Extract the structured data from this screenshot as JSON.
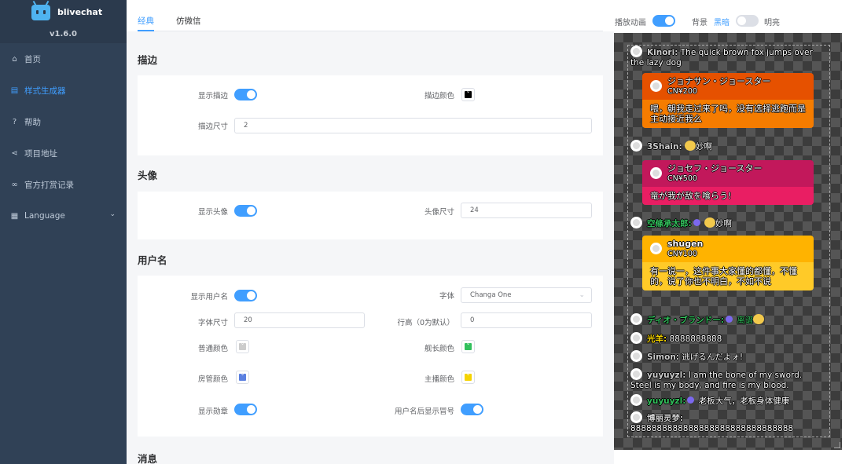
{
  "app": {
    "title": "blivechat",
    "version": "v1.6.0"
  },
  "sidebar": {
    "items": [
      {
        "label": "首页"
      },
      {
        "label": "样式生成器"
      },
      {
        "label": "帮助"
      },
      {
        "label": "项目地址"
      },
      {
        "label": "官方打赏记录"
      },
      {
        "label": "Language"
      }
    ]
  },
  "tabs": [
    "经典",
    "仿微信"
  ],
  "sections": {
    "outline": {
      "title": "描边",
      "show_label": "显示描边",
      "color_label": "描边颜色",
      "color": "#000000",
      "size_label": "描边尺寸",
      "size": "2"
    },
    "avatar": {
      "title": "头像",
      "show_label": "显示头像",
      "size_label": "头像尺寸",
      "size": "24"
    },
    "username": {
      "title": "用户名",
      "show_label": "显示用户名",
      "font_label": "字体",
      "font": "Changa One",
      "fontsize_label": "字体尺寸",
      "fontsize": "20",
      "lineheight_label": "行高（0为默认）",
      "lineheight": "0",
      "normal_color_label": "普通颜色",
      "normal_color": "#cccccc",
      "captain_color_label": "舰长颜色",
      "captain_color": "#32c05c",
      "admin_color_label": "房管颜色",
      "admin_color": "#5a7fe0",
      "owner_color_label": "主播颜色",
      "owner_color": "#f5d300",
      "medal_label": "显示勋章",
      "after_medal_label": "用户名后显示冒号"
    },
    "message": {
      "title": "消息"
    }
  },
  "topbar": {
    "anim_label": "播放动画",
    "bg_label": "背景",
    "dark_label": "黑暗",
    "light_label": "明亮"
  },
  "colors": {
    "accent": "#409eff",
    "sidebar": "#304156"
  },
  "preview": {
    "m1": {
      "name": "Kinori:",
      "text": "The quick brown fox jumps over the lazy dog"
    },
    "sc1": {
      "name": "ジョナサン・ジョースター",
      "price": "CN¥200",
      "text": "喂，朝我走过来了吗，没有选择逃跑而是主动接近我么"
    },
    "m2": {
      "name": "3Shain:",
      "text": "妙啊"
    },
    "sc2": {
      "name": "ジョセフ・ジョースター",
      "price": "CN¥500",
      "text": "竜が我が敌を喰らう!"
    },
    "m3": {
      "name": "空條承太郎:",
      "text": "妙啊"
    },
    "sc3": {
      "name": "shugen",
      "price": "CN¥100",
      "text": "有一说一，这件事大家懂的都懂，不懂的，说了你也不明白，不如不说"
    },
    "m4": {
      "name": "ディオ・ブランドー:",
      "text": "离谱"
    },
    "m5": {
      "name": "光羊:",
      "text": "8888888888"
    },
    "m6": {
      "name": "Simon:",
      "text": "逃げるんだよォ!"
    },
    "m7": {
      "name": "yuyuyzl:",
      "text": "I am the bone of my sword. Steel is my body, and fire is my blood."
    },
    "m8": {
      "name": "yuyuyzl:",
      "text": "老板大气，老板身体健康"
    },
    "m9": {
      "name": "博丽灵梦:",
      "text": "8888888888888888888888888888888"
    }
  }
}
